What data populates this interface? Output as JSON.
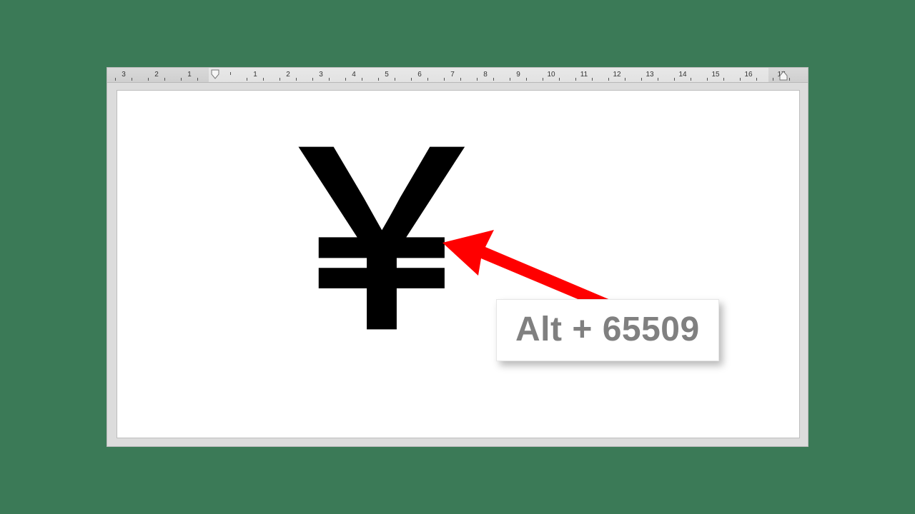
{
  "ruler": {
    "numbers": [
      "3",
      "2",
      "1",
      "",
      "1",
      "2",
      "3",
      "4",
      "5",
      "6",
      "7",
      "8",
      "9",
      "10",
      "11",
      "12",
      "13",
      "14",
      "15",
      "16",
      "17"
    ]
  },
  "document": {
    "symbol": "￥"
  },
  "annotation": {
    "callout_label": "Alt + 65509"
  },
  "colors": {
    "page_bg": "#3b7a57",
    "arrow": "#ff0000",
    "callout_text": "#808080"
  }
}
